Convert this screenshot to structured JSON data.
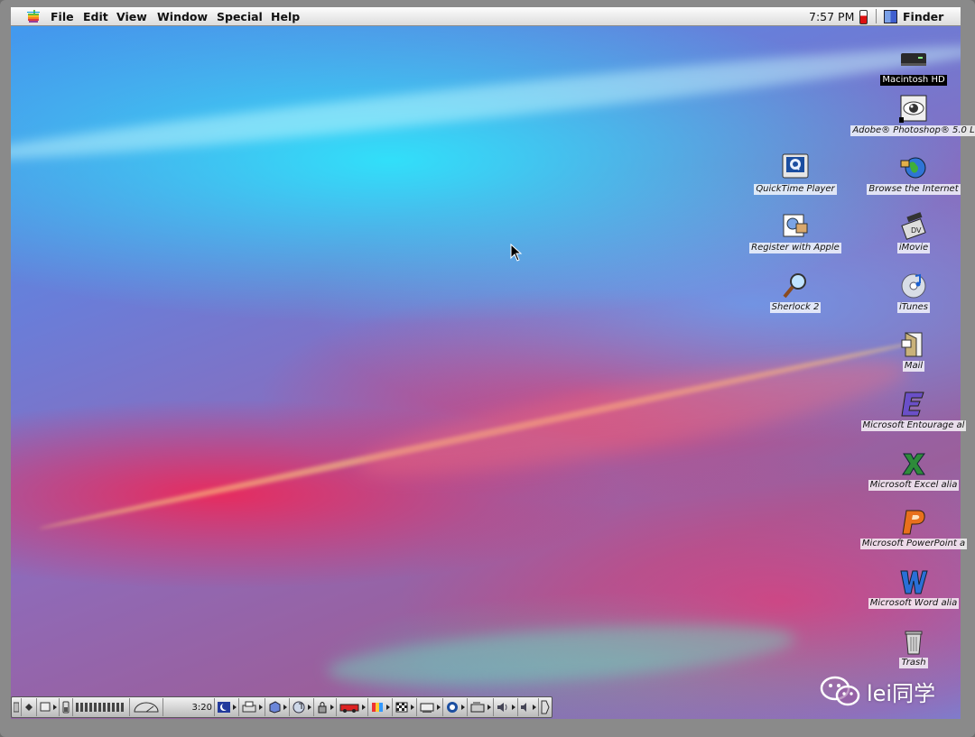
{
  "menubar": {
    "apple_menu_icon": "apple-logo-icon",
    "items": [
      {
        "label": "File"
      },
      {
        "label": "Edit"
      },
      {
        "label": "View"
      },
      {
        "label": "Window"
      },
      {
        "label": "Special"
      },
      {
        "label": "Help"
      }
    ],
    "clock": "7:57 PM",
    "active_app": "Finder"
  },
  "desktop_icons": [
    {
      "label": "Macintosh HD",
      "icon": "hard-drive-icon",
      "selected": true
    },
    {
      "label": "Adobe® Photoshop® 5.0 L",
      "icon": "photoshop-eye-icon"
    },
    {
      "label": "QuickTime Player",
      "icon": "quicktime-icon"
    },
    {
      "label": "Browse the Internet",
      "icon": "internet-globe-icon"
    },
    {
      "label": "Register with Apple",
      "icon": "register-icon"
    },
    {
      "label": "iMovie",
      "icon": "imovie-icon"
    },
    {
      "label": "Sherlock 2",
      "icon": "magnifier-icon"
    },
    {
      "label": "iTunes",
      "icon": "itunes-cd-icon"
    },
    {
      "label": "Mail",
      "icon": "mail-icon"
    },
    {
      "label": "Microsoft Entourage al",
      "icon": "entourage-icon"
    },
    {
      "label": "Microsoft Excel alia",
      "icon": "excel-icon"
    },
    {
      "label": "Microsoft PowerPoint a",
      "icon": "powerpoint-icon"
    },
    {
      "label": "Microsoft Word alia",
      "icon": "word-icon"
    },
    {
      "label": "Trash",
      "icon": "trash-icon"
    }
  ],
  "control_strip": {
    "battery_time": "3:20"
  },
  "watermark": {
    "text": "lei同学",
    "icon": "wechat-icon"
  },
  "colors": {
    "menubar_bg": "#e8e8e8",
    "label_bg": "#ffffff",
    "selected_label_bg": "#000000",
    "battery_red": "#dd1111"
  }
}
